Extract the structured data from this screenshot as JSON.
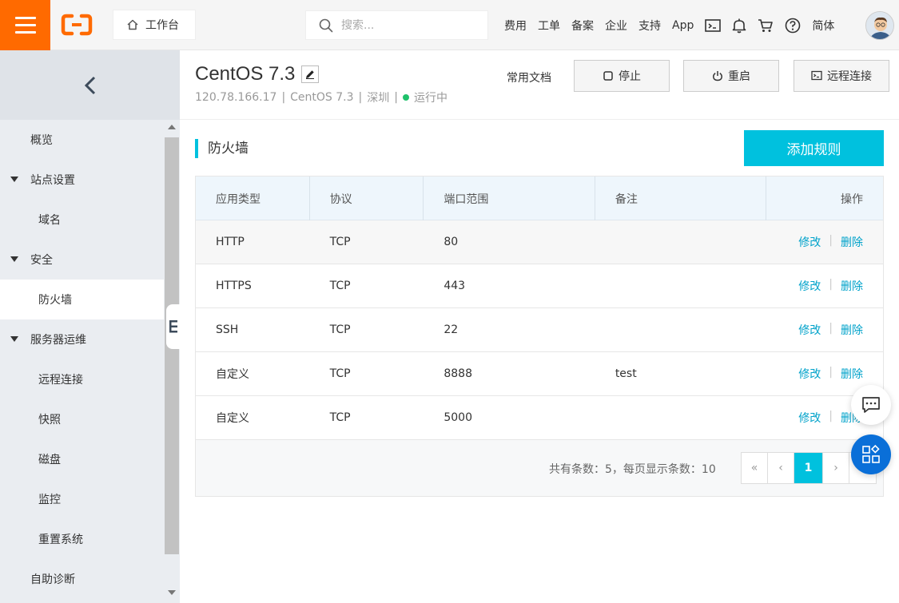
{
  "topbar": {
    "workbench_label": "工作台",
    "search_placeholder": "搜索...",
    "nav": [
      "费用",
      "工单",
      "备案",
      "企业",
      "支持",
      "App"
    ],
    "lang": "简体"
  },
  "sidebar": {
    "items": [
      {
        "label": "概览",
        "level": 1,
        "expandable": false,
        "active": false
      },
      {
        "label": "站点设置",
        "level": 1,
        "expandable": true,
        "active": false
      },
      {
        "label": "域名",
        "level": 2,
        "expandable": false,
        "active": false
      },
      {
        "label": "安全",
        "level": 1,
        "expandable": true,
        "active": false
      },
      {
        "label": "防火墙",
        "level": 2,
        "expandable": false,
        "active": true
      },
      {
        "label": "服务器运维",
        "level": 1,
        "expandable": true,
        "active": false
      },
      {
        "label": "远程连接",
        "level": 2,
        "expandable": false,
        "active": false
      },
      {
        "label": "快照",
        "level": 2,
        "expandable": false,
        "active": false
      },
      {
        "label": "磁盘",
        "level": 2,
        "expandable": false,
        "active": false
      },
      {
        "label": "监控",
        "level": 2,
        "expandable": false,
        "active": false
      },
      {
        "label": "重置系统",
        "level": 2,
        "expandable": false,
        "active": false
      },
      {
        "label": "自助诊断",
        "level": 1,
        "expandable": false,
        "active": false
      }
    ]
  },
  "instance": {
    "name": "CentOS 7.3",
    "ip": "120.78.166.17",
    "os": "CentOS 7.3",
    "region": "深圳",
    "status": "运行中",
    "docs_label": "常用文档",
    "stop_label": "停止",
    "restart_label": "重启",
    "remote_label": "远程连接"
  },
  "firewall": {
    "title": "防火墙",
    "add_label": "添加规则",
    "columns": [
      "应用类型",
      "协议",
      "端口范围",
      "备注",
      "操作"
    ],
    "rows": [
      {
        "app": "HTTP",
        "protocol": "TCP",
        "port": "80",
        "note": ""
      },
      {
        "app": "HTTPS",
        "protocol": "TCP",
        "port": "443",
        "note": ""
      },
      {
        "app": "SSH",
        "protocol": "TCP",
        "port": "22",
        "note": ""
      },
      {
        "app": "自定义",
        "protocol": "TCP",
        "port": "8888",
        "note": "test"
      },
      {
        "app": "自定义",
        "protocol": "TCP",
        "port": "5000",
        "note": ""
      }
    ],
    "edit_label": "修改",
    "delete_label": "删除",
    "summary": "共有条数：5，每页显示条数：10",
    "pager": [
      "«",
      "‹",
      "1",
      "›",
      "»"
    ],
    "current_page": "1"
  },
  "colors": {
    "brand_orange": "#ff6a00",
    "accent_cyan": "#00c1de",
    "link_blue": "#00a2ca",
    "status_green": "#1fc16b",
    "float_blue": "#0a6fd8"
  }
}
